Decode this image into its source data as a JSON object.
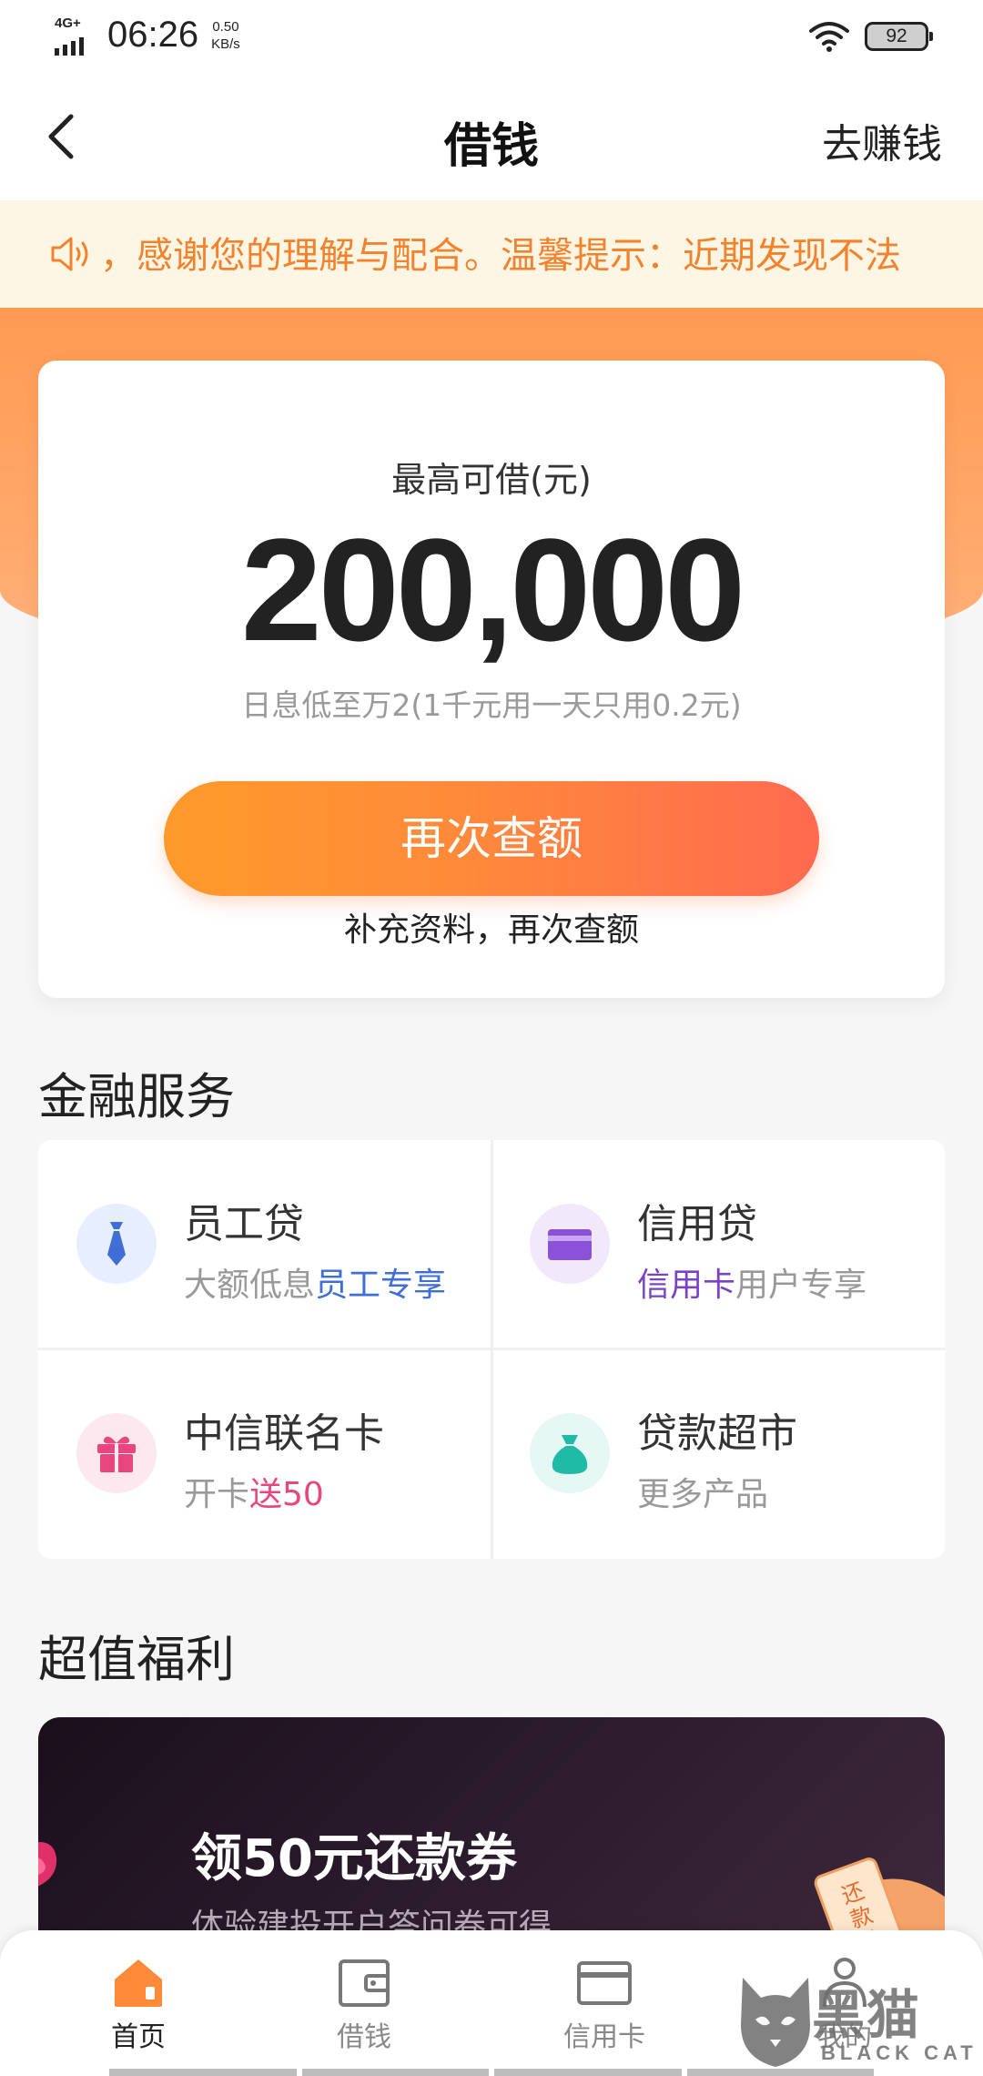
{
  "status_bar": {
    "network": "4G+",
    "time": "06:26",
    "speed_value": "0.50",
    "speed_unit": "KB/s",
    "battery": "92"
  },
  "nav": {
    "title": "借钱",
    "action": "去赚钱"
  },
  "notice": {
    "text": "，感谢您的理解与配合。温馨提示：近期发现不法"
  },
  "credit": {
    "limit_label": "最高可借(元)",
    "limit_amount": "200,000",
    "rate_text": "日息低至万2(1千元用一天只用0.2元)",
    "button_label": "再次查额",
    "sub_text": "补充资料，再次查额"
  },
  "finance": {
    "title": "金融服务",
    "items": [
      {
        "name": "员工贷",
        "desc_plain": "大额低息",
        "desc_highlight": "员工专享",
        "icon": "tie-icon",
        "icon_bg": "#e6eeff"
      },
      {
        "name": "信用贷",
        "desc_highlight": "信用卡",
        "desc_plain": "用户专享",
        "icon": "card-icon",
        "icon_bg": "#f1e9fb"
      },
      {
        "name": "中信联名卡",
        "desc_plain": "开卡",
        "desc_highlight": "送50",
        "icon": "gift-icon",
        "icon_bg": "#fde8ef"
      },
      {
        "name": "贷款超市",
        "desc_plain": "更多产品",
        "icon": "money-bag-icon",
        "icon_bg": "#e5f8f4"
      }
    ]
  },
  "welfare": {
    "title": "超值福利",
    "promo_title": "领50元还款券",
    "promo_sub": "体验建投开户答问卷可得",
    "coupon_text": "还款券"
  },
  "tabs": [
    {
      "label": "首页",
      "active": true,
      "icon": "home-icon"
    },
    {
      "label": "借钱",
      "active": false,
      "icon": "wallet-icon"
    },
    {
      "label": "信用卡",
      "active": false,
      "icon": "credit-card-icon"
    },
    {
      "label": "我的",
      "active": false,
      "icon": "person-icon"
    }
  ],
  "watermark": {
    "cn": "黑猫",
    "en": "BLACK CAT"
  },
  "colors": {
    "accent_orange": "#ff8a3a",
    "notice_text": "#f2822c",
    "highlight_blue": "#3f6ed6",
    "highlight_purple": "#7a43c7",
    "highlight_pink": "#e8467e"
  }
}
